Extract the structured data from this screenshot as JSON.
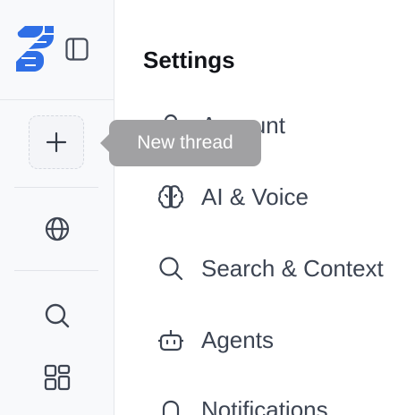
{
  "sidebar": {
    "new_thread_tooltip": "New thread"
  },
  "settings": {
    "title": "Settings",
    "items": [
      {
        "label": "Account",
        "icon": "user-icon"
      },
      {
        "label": "AI & Voice",
        "icon": "brain-icon"
      },
      {
        "label": "Search & Context",
        "icon": "search-icon"
      },
      {
        "label": "Agents",
        "icon": "bot-icon"
      },
      {
        "label": "Notifications",
        "icon": "bell-icon"
      }
    ]
  },
  "colors": {
    "brand": "#2f6fe6",
    "text": "#3c4452",
    "tooltip_bg": "#a1a1a3"
  }
}
